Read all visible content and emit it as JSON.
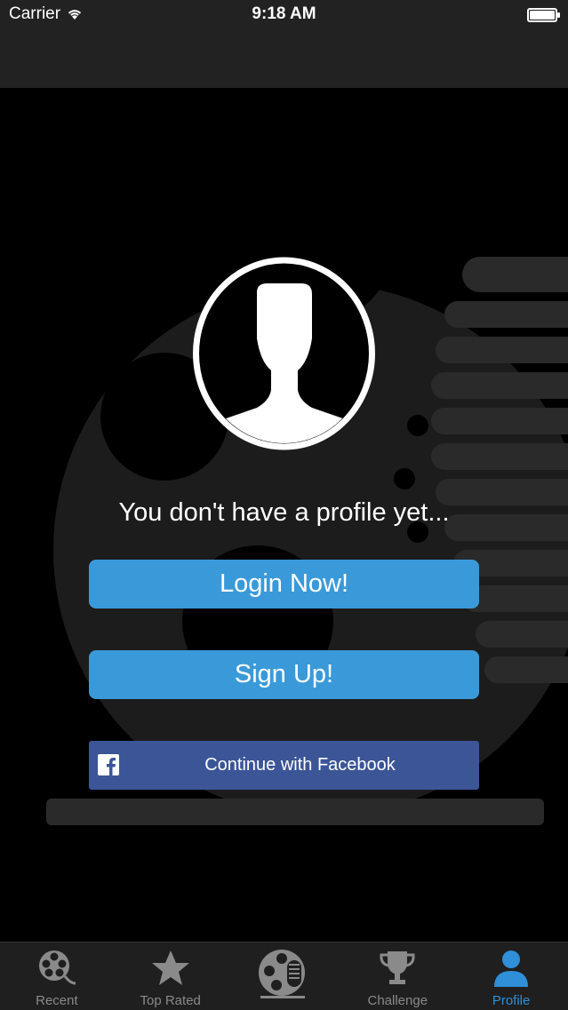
{
  "status_bar": {
    "carrier": "Carrier",
    "time": "9:18 AM"
  },
  "profile": {
    "empty_message": "You don't have a profile yet...",
    "login_label": "Login Now!",
    "signup_label": "Sign Up!",
    "facebook_label": "Continue with Facebook"
  },
  "tabs": [
    {
      "label": "Recent",
      "icon": "film-reel-icon",
      "active": false
    },
    {
      "label": "Top Rated",
      "icon": "star-icon",
      "active": false
    },
    {
      "label": "",
      "icon": "film-mic-logo-icon",
      "active": false
    },
    {
      "label": "Challenge",
      "icon": "trophy-icon",
      "active": false
    },
    {
      "label": "Profile",
      "icon": "person-icon",
      "active": true
    }
  ],
  "colors": {
    "button_blue": "#3a9ad9",
    "facebook_blue": "#3b5597",
    "tab_active": "#2f8fd8",
    "tab_inactive": "#8a8a8a"
  }
}
